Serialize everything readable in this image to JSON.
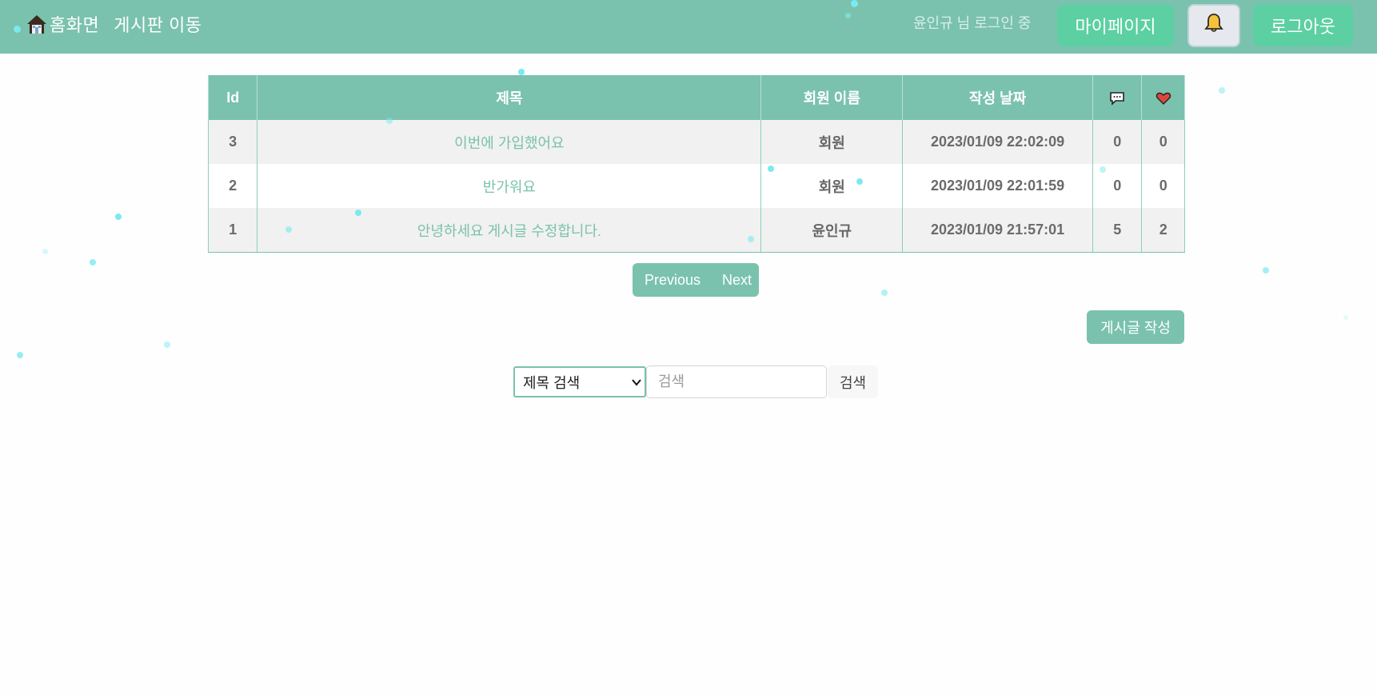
{
  "nav": {
    "home_label": "홈화면",
    "board_label": "게시판 이동",
    "login_status": "윤인규 님 로그인 중",
    "mypage_label": "마이페이지",
    "logout_label": "로그아웃"
  },
  "table": {
    "headers": {
      "id": "Id",
      "title": "제목",
      "author": "회원 이름",
      "date": "작성 날짜"
    },
    "rows": [
      {
        "id": "3",
        "title": "이번에 가입했어요",
        "author": "회원",
        "date": "2023/01/09 22:02:09",
        "comments": "0",
        "likes": "0"
      },
      {
        "id": "2",
        "title": "반가워요",
        "author": "회원",
        "date": "2023/01/09 22:01:59",
        "comments": "0",
        "likes": "0"
      },
      {
        "id": "1",
        "title": "안녕하세요 게시글 수정합니다.",
        "author": "윤인규",
        "date": "2023/01/09 21:57:01",
        "comments": "5",
        "likes": "2"
      }
    ]
  },
  "pager": {
    "previous_label": "Previous",
    "next_label": "Next"
  },
  "write_label": "게시글 작성",
  "search": {
    "type_selected": "제목 검색",
    "placeholder": "검색",
    "button_label": "검색"
  },
  "colors": {
    "accent": "#7ac2ad",
    "button_green": "#5cd0a3",
    "heart": "#d9473e"
  },
  "icons": [
    "home-icon",
    "bell-icon",
    "comment-icon",
    "heart-icon",
    "chevron-down-icon"
  ]
}
